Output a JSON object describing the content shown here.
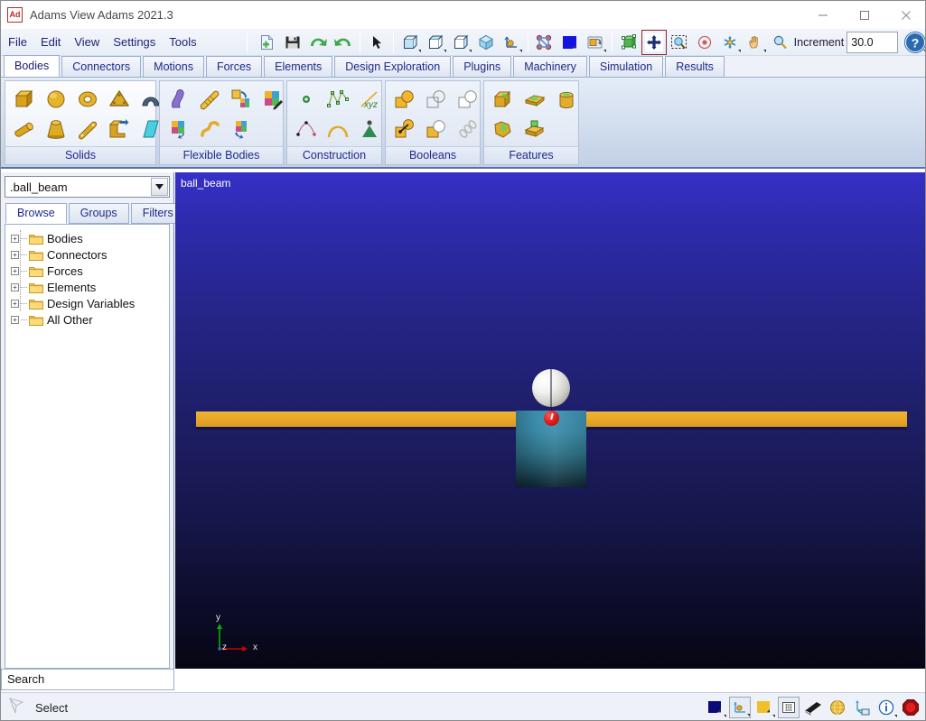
{
  "window": {
    "title": "Adams View Adams 2021.3",
    "logo_text": "Ad",
    "controls": [
      {
        "name": "minimize",
        "glyph": "—"
      },
      {
        "name": "maximize",
        "glyph": "□"
      },
      {
        "name": "close",
        "glyph": "✕"
      }
    ]
  },
  "menu": {
    "items": [
      {
        "label": "File"
      },
      {
        "label": "Edit"
      },
      {
        "label": "View"
      },
      {
        "label": "Settings"
      },
      {
        "label": "Tools"
      }
    ]
  },
  "toolbar": {
    "groups": [
      {
        "name": "file-group",
        "buttons": [
          {
            "icon": "new-document-icon",
            "label": "New"
          },
          {
            "icon": "save-icon",
            "label": "Save"
          },
          {
            "icon": "undo-icon",
            "label": "Undo"
          },
          {
            "icon": "redo-icon",
            "label": "Redo"
          }
        ]
      },
      {
        "name": "select-group",
        "buttons": [
          {
            "icon": "pointer-icon",
            "label": "Select"
          }
        ]
      },
      {
        "name": "view-group",
        "buttons": [
          {
            "icon": "front-view-icon",
            "label": "Front View"
          },
          {
            "icon": "top-view-icon",
            "label": "Top View"
          },
          {
            "icon": "right-view-icon",
            "label": "Right View"
          },
          {
            "icon": "iso-view-icon",
            "label": "Isometric View"
          },
          {
            "icon": "axis-triad-icon",
            "label": "Working Grid"
          }
        ]
      },
      {
        "name": "render-group",
        "buttons": [
          {
            "icon": "render-mode-icon",
            "label": "Render Mode"
          },
          {
            "icon": "background-color-icon",
            "label": "Background Color"
          },
          {
            "icon": "view-rotate-icon",
            "label": "Rotate View"
          }
        ]
      },
      {
        "name": "navigate-group",
        "buttons": [
          {
            "icon": "fit-model-icon",
            "label": "Fit Model"
          },
          {
            "icon": "translate-view-icon",
            "label": "Translate View"
          },
          {
            "icon": "zoom-box-icon",
            "label": "Zoom Box"
          },
          {
            "icon": "center-view-icon",
            "label": "Center View"
          },
          {
            "icon": "rotate-dynamic-icon",
            "label": "Dynamic Rotate"
          },
          {
            "icon": "pan-hand-icon",
            "label": "Pan"
          },
          {
            "icon": "zoom-icon",
            "label": "Zoom"
          }
        ]
      }
    ],
    "increment_label": "Increment",
    "increment_value": "30.0",
    "help_icon": "help-icon"
  },
  "ribbon": {
    "tabs": [
      {
        "label": "Bodies",
        "active": true
      },
      {
        "label": "Connectors",
        "active": false
      },
      {
        "label": "Motions",
        "active": false
      },
      {
        "label": "Forces",
        "active": false
      },
      {
        "label": "Elements",
        "active": false
      },
      {
        "label": "Design Exploration",
        "active": false
      },
      {
        "label": "Plugins",
        "active": false
      },
      {
        "label": "Machinery",
        "active": false
      },
      {
        "label": "Simulation",
        "active": false
      },
      {
        "label": "Results",
        "active": false
      }
    ],
    "groups": [
      {
        "label": "Solids",
        "active": true,
        "icons": [
          "box-solid-icon",
          "link-solid-icon",
          "sphere-solid-icon",
          "frustum-solid-icon",
          "torus-solid-icon",
          "cylinder-solid-icon",
          "plate-solid-icon",
          "extrusion-solid-icon",
          "revolution-solid-icon",
          "plane-solid-icon"
        ]
      },
      {
        "label": "Flexible Bodies",
        "active": false,
        "icons": [
          "flex-body-icon",
          "rigid-to-flex-icon",
          "beam-flex-icon",
          "flex-cable-icon",
          "discrete-flex-icon",
          "flex-swap-icon",
          "flex-edit-icon"
        ]
      },
      {
        "label": "Construction",
        "active": false,
        "icons": [
          "marker-point-icon",
          "spline-point-icon",
          "polyline-icon",
          "arc-icon",
          "csys-xyz-icon",
          "contour-icon"
        ]
      },
      {
        "label": "Booleans",
        "active": false,
        "icons": [
          "unite-icon",
          "merge-icon",
          "intersect-icon",
          "subtract-icon",
          "chamfer-bool-icon",
          "chain-link-icon"
        ]
      },
      {
        "label": "Features",
        "active": false,
        "icons": [
          "fillet-feature-icon",
          "chamfer-feature-icon",
          "hollow-feature-icon",
          "boss-feature-icon",
          "hole-feature-icon"
        ]
      }
    ]
  },
  "browser": {
    "model_name": ".ball_beam",
    "tabs": [
      {
        "label": "Browse",
        "active": true
      },
      {
        "label": "Groups",
        "active": false
      },
      {
        "label": "Filters",
        "active": false
      }
    ],
    "tree": [
      {
        "label": "Bodies",
        "expander": "+"
      },
      {
        "label": "Connectors",
        "expander": "+"
      },
      {
        "label": "Forces",
        "expander": "+"
      },
      {
        "label": "Elements",
        "expander": "+"
      },
      {
        "label": "Design Variables",
        "expander": "+"
      },
      {
        "label": "All Other",
        "expander": "+"
      }
    ],
    "search_placeholder": "Search"
  },
  "viewport": {
    "label": "ball_beam",
    "triad": {
      "y_label": "y",
      "x_label": "x",
      "z_label": "z",
      "y_color": "#00b200",
      "x_color": "#cc0000",
      "z_color": "#3a5fd0"
    },
    "colors": {
      "beam": "#e8a92b",
      "support_block": "#3d8fae",
      "ball": "#e8e8e2",
      "marker": "#e02020",
      "background_top": "#3630c8",
      "background_bottom": "#060614"
    }
  },
  "statusbar": {
    "mode_icon": "select-arrow-icon",
    "mode_label": "Select",
    "buttons": [
      {
        "icon": "render-shaded-icon",
        "label": "Render Mode"
      },
      {
        "icon": "axis-triad-toggle-icon",
        "label": "Toggle Triad"
      },
      {
        "icon": "background-color-icon",
        "label": "Background Color"
      },
      {
        "icon": "working-grid-icon",
        "label": "Working Grid"
      },
      {
        "icon": "shading-icon",
        "label": "Shading"
      },
      {
        "icon": "globe-icon",
        "label": "Depth Cue"
      },
      {
        "icon": "coordinate-window-icon",
        "label": "Coordinate Window"
      },
      {
        "icon": "information-icon",
        "label": "Information"
      },
      {
        "icon": "stop-icon",
        "label": "Stop"
      }
    ]
  }
}
